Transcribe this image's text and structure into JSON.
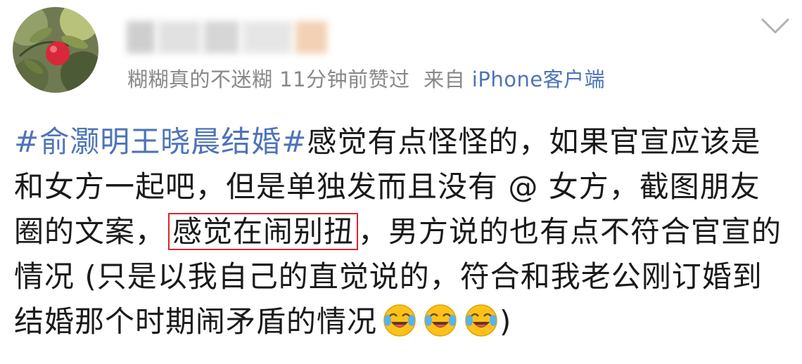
{
  "header": {
    "meta_prefix": "糊糊真的不迷糊 11分钟前赞过",
    "meta_source_label": "来自",
    "meta_source": "iPhone客户端"
  },
  "post": {
    "hashtag": "#俞灏明王晓晨结婚#",
    "text_1": "感觉有点怪怪的，如果官宣应该是和女方一起吧，但是单独发而且没有 @ 女方，截图朋友圈的文案，",
    "highlighted": "感觉在闹别扭",
    "text_2": "，男方说的也有点不符合官宣的情况 (只是以我自己的直觉说的，符合和我老公刚订婚到结婚那个时期闹矛盾的情况",
    "text_end": ")"
  },
  "icons": {
    "avatar": "avatar-image",
    "more": "chevron-down-icon",
    "emoji": "laugh-cry-emoji-icon"
  },
  "colors": {
    "link": "#4e74b8",
    "meta": "#888888",
    "highlight_border": "#d4282d"
  }
}
